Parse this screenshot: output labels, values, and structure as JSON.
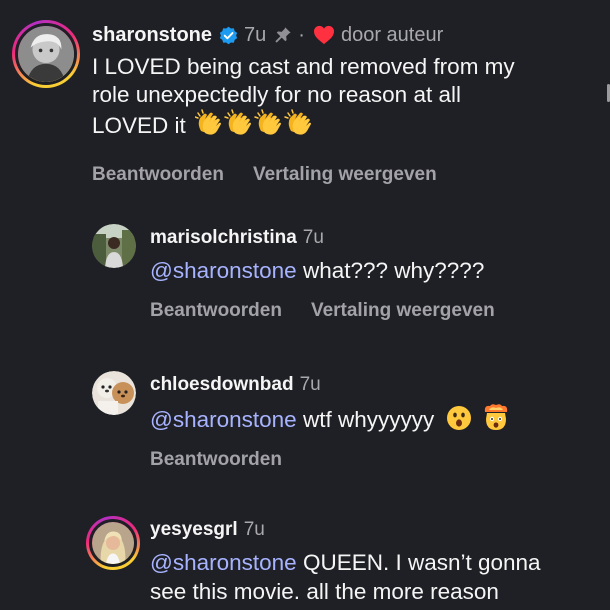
{
  "comments": [
    {
      "username": "sharonstone",
      "time": "7u",
      "separator": "·",
      "creator_badge": "door auteur",
      "text_lines": [
        "I LOVED being cast and removed from my",
        "role unexpectedly for no reason at all",
        "LOVED it"
      ],
      "emoji": "clapping-hands x4",
      "actions": [
        "Beantwoorden",
        "Vertaling weergeven"
      ]
    },
    {
      "username": "marisolchristina",
      "time": "7u",
      "mention": "@sharonstone",
      "text": "what??? why????",
      "actions": [
        "Beantwoorden",
        "Vertaling weergeven"
      ]
    },
    {
      "username": "chloesdownbad",
      "time": "7u",
      "mention": "@sharonstone",
      "text": "wtf whyyyyyy",
      "emoji": "hushed-face, exploding-head",
      "actions": [
        "Beantwoorden"
      ]
    },
    {
      "username": "yesyesgrl",
      "time": "7u",
      "mention": "@sharonstone",
      "text": "QUEEN. I wasn’t gonna",
      "text_line2": "see this movie. all the more reason"
    }
  ],
  "colors": {
    "background": "#1f2025",
    "mention": "#a7b3ff",
    "heart": "#ff3040",
    "verified": "#1d9bf0"
  }
}
